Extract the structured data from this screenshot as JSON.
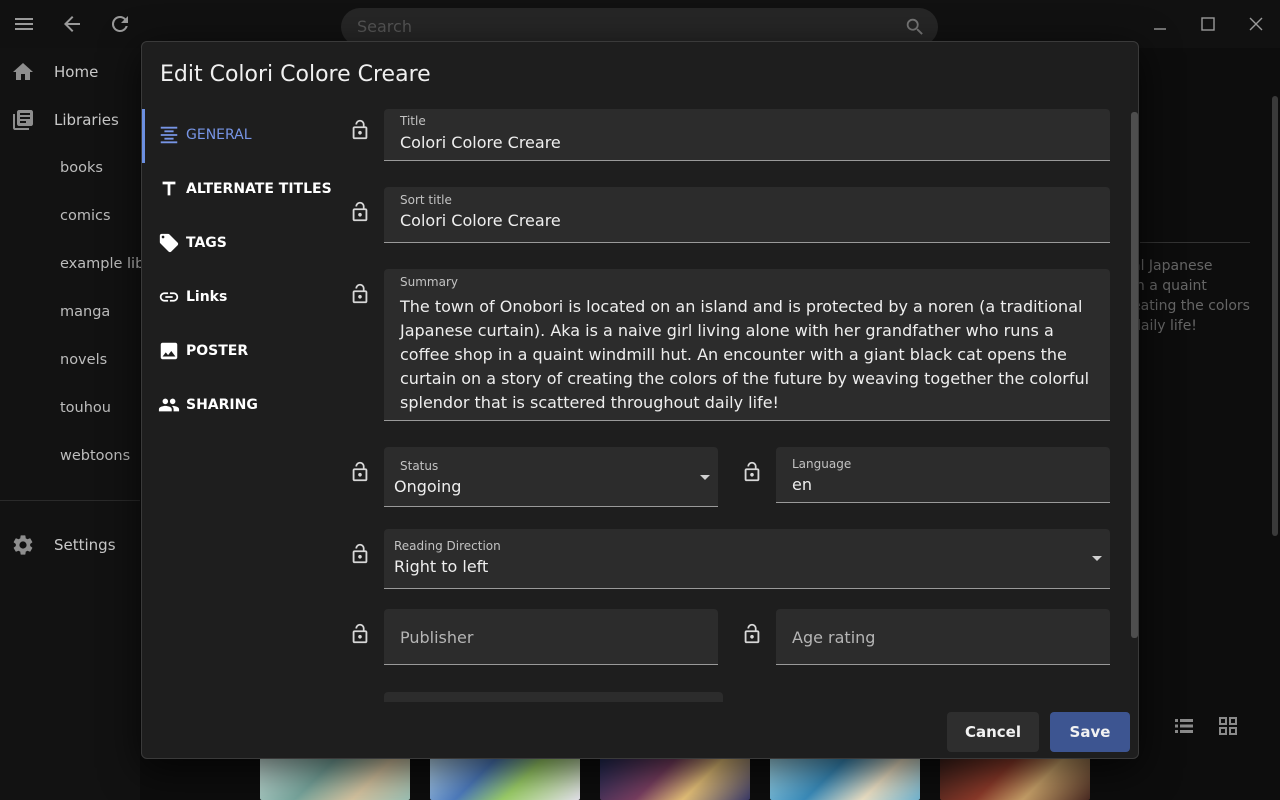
{
  "search": {
    "placeholder": "Search"
  },
  "sidebar": {
    "home": "Home",
    "libraries": "Libraries",
    "library_items": [
      "books",
      "comics",
      "example library",
      "manga",
      "novels",
      "touhou",
      "webtoons"
    ],
    "settings": "Settings"
  },
  "background": {
    "summary_fragment_lines": [
      "al Japanese",
      "in a quaint",
      "eating the colors",
      "daily life!"
    ]
  },
  "dialog": {
    "title": "Edit Colori Colore Creare",
    "tabs": [
      {
        "label": "GENERAL",
        "icon": "align-center-icon",
        "active": true
      },
      {
        "label": "ALTERNATE TITLES",
        "icon": "text-t-icon",
        "active": false
      },
      {
        "label": "TAGS",
        "icon": "tag-icon",
        "active": false
      },
      {
        "label": "Links",
        "icon": "link-icon",
        "active": false
      },
      {
        "label": "POSTER",
        "icon": "image-icon",
        "active": false
      },
      {
        "label": "SHARING",
        "icon": "people-icon",
        "active": false
      }
    ],
    "fields": {
      "title": {
        "label": "Title",
        "value": "Colori Colore Creare"
      },
      "sort_title": {
        "label": "Sort title",
        "value": "Colori Colore Creare"
      },
      "summary": {
        "label": "Summary",
        "value": "The town of Onobori is located on an island and is protected by a noren (a traditional Japanese curtain). Aka is a naive girl living alone with her grandfather who runs a coffee shop in a quaint windmill hut. An encounter with a giant black cat opens the curtain on a story of creating the colors of the future by weaving together the colorful splendor that is scattered throughout daily life!"
      },
      "status": {
        "label": "Status",
        "value": "Ongoing"
      },
      "language": {
        "label": "Language",
        "value": "en"
      },
      "reading_direction": {
        "label": "Reading Direction",
        "value": "Right to left"
      },
      "publisher": {
        "placeholder": "Publisher",
        "value": ""
      },
      "age_rating": {
        "placeholder": "Age rating",
        "value": ""
      }
    },
    "buttons": {
      "cancel": "Cancel",
      "save": "Save"
    }
  },
  "colors": {
    "accent": "#7795e6",
    "save_button": "#3d5591",
    "dialog_bg": "#1e1e1e",
    "field_bg": "#2c2c2c"
  }
}
